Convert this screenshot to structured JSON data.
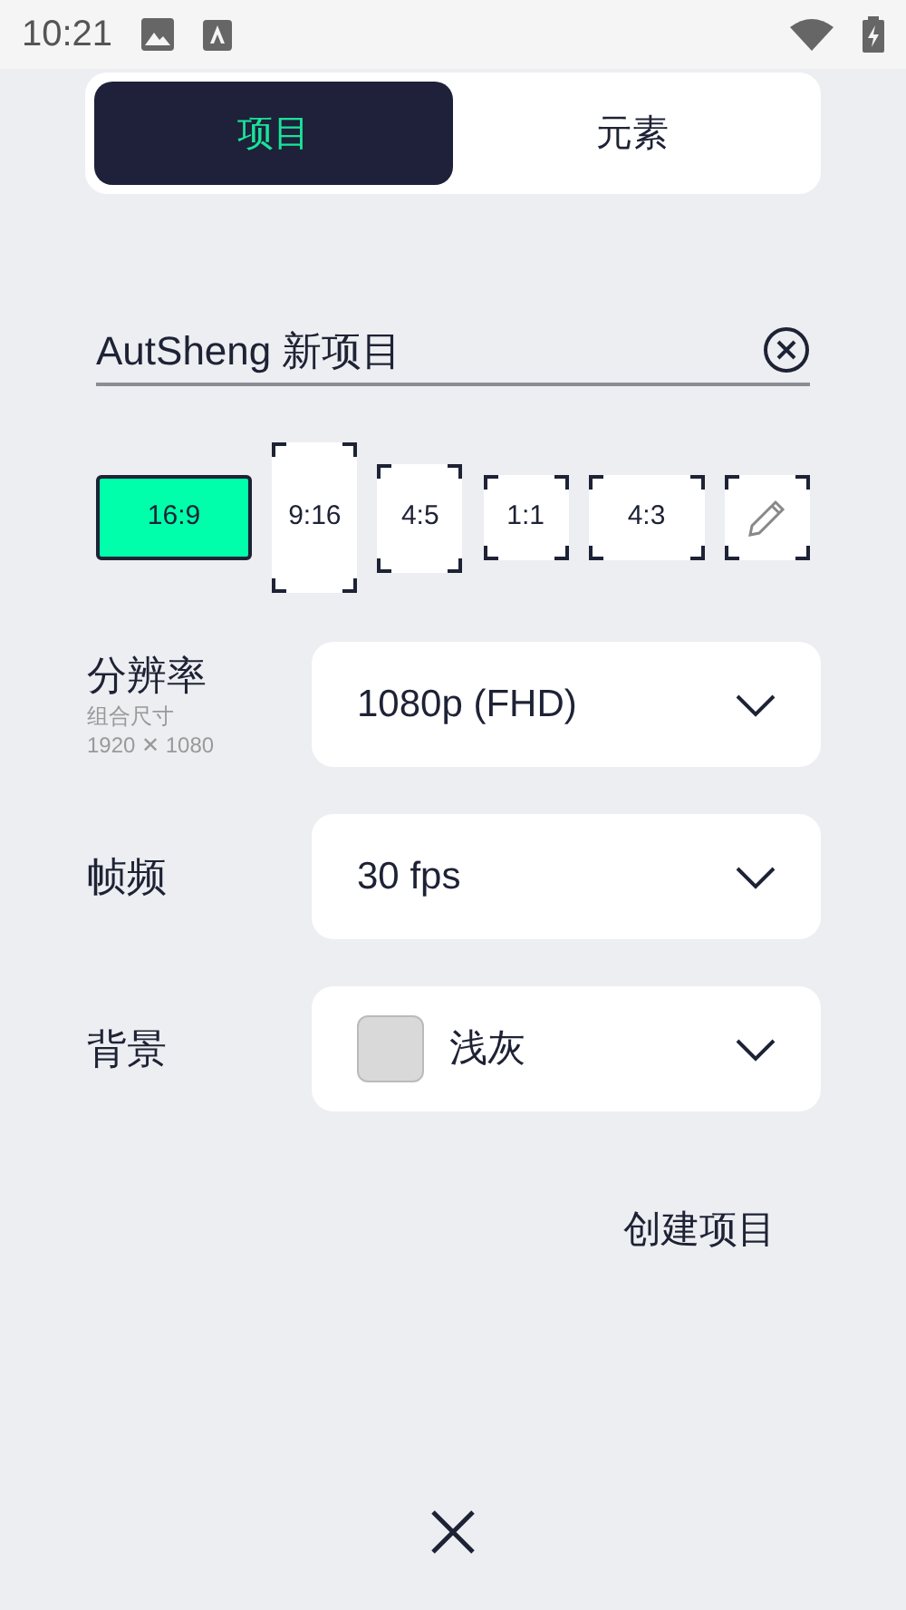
{
  "status_bar": {
    "time": "10:21"
  },
  "tabs": [
    {
      "label": "项目",
      "selected": true
    },
    {
      "label": "元素",
      "selected": false
    }
  ],
  "project_name": {
    "value": "AutSheng 新项目"
  },
  "aspect_ratios": [
    {
      "kind": "ratio",
      "label": "16:9",
      "selected": true
    },
    {
      "kind": "ratio",
      "label": "9:16",
      "selected": false
    },
    {
      "kind": "ratio",
      "label": "4:5",
      "selected": false
    },
    {
      "kind": "ratio",
      "label": "1:1",
      "selected": false
    },
    {
      "kind": "ratio",
      "label": "4:3",
      "selected": false
    },
    {
      "kind": "edit",
      "selected": false
    }
  ],
  "settings": [
    {
      "label": "分辨率",
      "sublabel": "组合尺寸",
      "detail": "1920 ✕ 1080",
      "value": "1080p (FHD)"
    },
    {
      "label": "帧频",
      "value": "30 fps"
    },
    {
      "label": "背景",
      "value": "浅灰",
      "color": "#d9d9d9"
    }
  ],
  "create_button": {
    "label": "创建项目"
  }
}
